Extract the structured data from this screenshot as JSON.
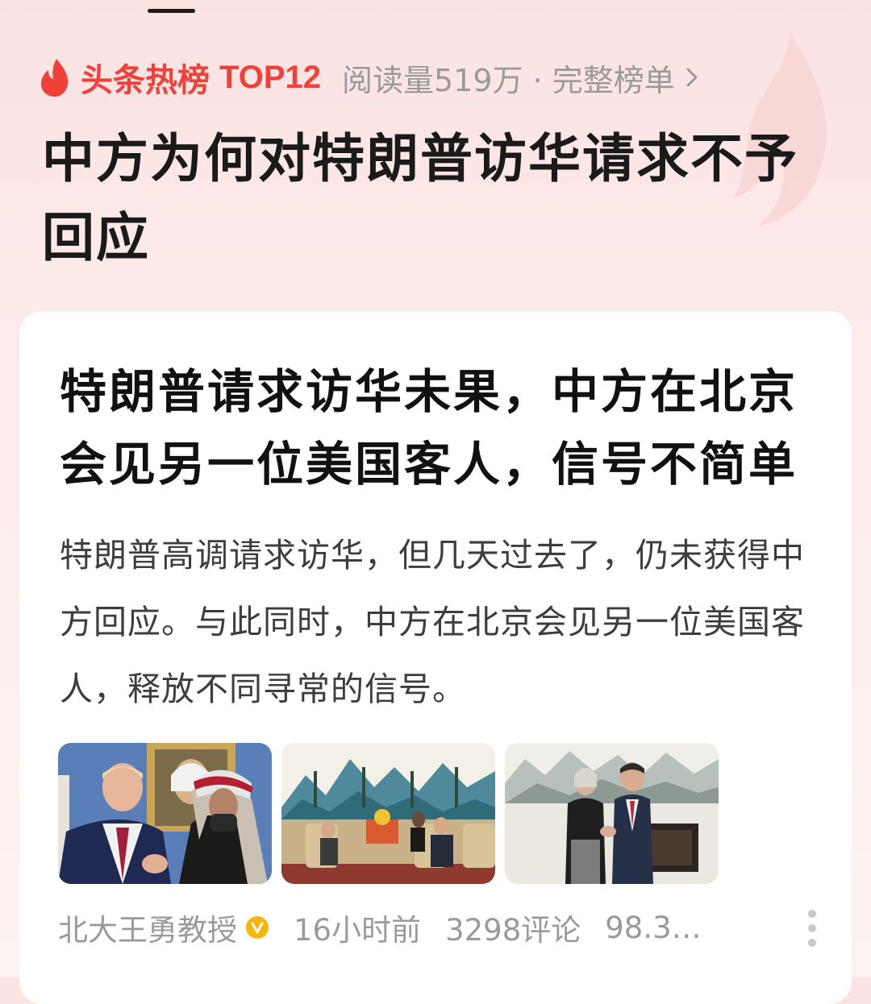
{
  "hot_list": {
    "label": "头条热榜",
    "rank": "TOP12",
    "read_info": "阅读量519万 · 完整榜单",
    "chevron_icon": "chevron-right-icon",
    "accent_color": "#f0403a"
  },
  "topic": {
    "title": "中方为何对特朗普访华请求不予回应"
  },
  "article": {
    "title": "特朗普请求访华未果，中方在北京会见另一位美国客人，信号不简单",
    "summary": "特朗普高调请求访华，但几天过去了，仍未获得中方回应。与此同时，中方在北京会见另一位美国客人，释放不同寻常的信号。",
    "images": [
      "photo-meeting-leaders",
      "photo-reception-hall",
      "photo-handshake"
    ],
    "author": "北大王勇教授",
    "verified_icon": "verified-badge-icon",
    "time": "16小时前",
    "comments": "3298评论",
    "reads": "98.3…",
    "more_icon": "more-vertical-icon"
  }
}
